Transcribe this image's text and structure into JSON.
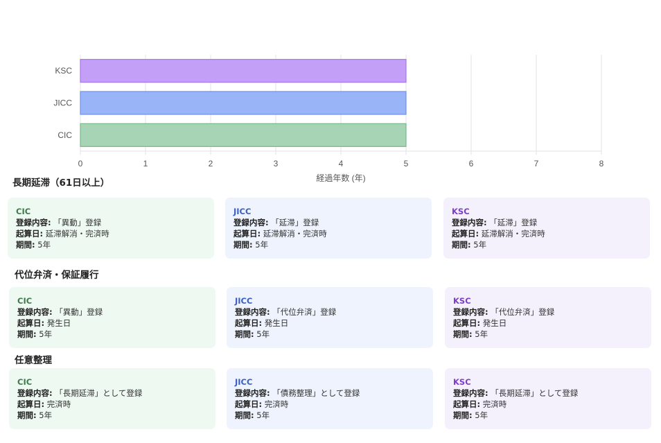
{
  "chart_data": {
    "type": "bar",
    "orientation": "horizontal",
    "categories": [
      "KSC",
      "JICC",
      "CIC"
    ],
    "values": [
      5,
      5,
      5
    ],
    "bar_colors": [
      "#c39ff7",
      "#99b5f7",
      "#a6d4b4"
    ],
    "bar_borders": [
      "#a774ef",
      "#6e8ff0",
      "#79b88b"
    ],
    "xlabel": "経過年数 (年)",
    "ylabel": "",
    "xlim": [
      0,
      8
    ],
    "x_ticks": [
      "0",
      "1",
      "2",
      "3",
      "4",
      "5",
      "6",
      "7",
      "8"
    ],
    "grid": true,
    "legend": "none"
  },
  "sections": [
    {
      "title": "長期延滞（61日以上）",
      "cards": [
        {
          "agency": "CIC",
          "reg_label": "登録内容:",
          "reg_value": "「異動」登録",
          "start_label": "起算日:",
          "start_value": "延滞解消・完済時",
          "period_label": "期間:",
          "period_value": "5年"
        },
        {
          "agency": "JICC",
          "reg_label": "登録内容:",
          "reg_value": "「延滞」登録",
          "start_label": "起算日:",
          "start_value": "延滞解消・完済時",
          "period_label": "期間:",
          "period_value": "5年"
        },
        {
          "agency": "KSC",
          "reg_label": "登録内容:",
          "reg_value": "「延滞」登録",
          "start_label": "起算日:",
          "start_value": "延滞解消・完済時",
          "period_label": "期間:",
          "period_value": "5年"
        }
      ]
    },
    {
      "title": "代位弁済・保証履行",
      "cards": [
        {
          "agency": "CIC",
          "reg_label": "登録内容:",
          "reg_value": "「異動」登録",
          "start_label": "起算日:",
          "start_value": "発生日",
          "period_label": "期間:",
          "period_value": "5年"
        },
        {
          "agency": "JICC",
          "reg_label": "登録内容:",
          "reg_value": "「代位弁済」登録",
          "start_label": "起算日:",
          "start_value": "発生日",
          "period_label": "期間:",
          "period_value": "5年"
        },
        {
          "agency": "KSC",
          "reg_label": "登録内容:",
          "reg_value": "「代位弁済」登録",
          "start_label": "起算日:",
          "start_value": "発生日",
          "period_label": "期間:",
          "period_value": "5年"
        }
      ]
    },
    {
      "title": "任意整理",
      "cards": [
        {
          "agency": "CIC",
          "reg_label": "登録内容:",
          "reg_value": "「長期延滞」として登録",
          "start_label": "起算日:",
          "start_value": "完済時",
          "period_label": "期間:",
          "period_value": "5年"
        },
        {
          "agency": "JICC",
          "reg_label": "登録内容:",
          "reg_value": "「債務整理」として登録",
          "start_label": "起算日:",
          "start_value": "完済時",
          "period_label": "期間:",
          "period_value": "5年"
        },
        {
          "agency": "KSC",
          "reg_label": "登録内容:",
          "reg_value": "「長期延滞」として登録",
          "start_label": "起算日:",
          "start_value": "完済時",
          "period_label": "期間:",
          "period_value": "5年"
        }
      ]
    }
  ]
}
